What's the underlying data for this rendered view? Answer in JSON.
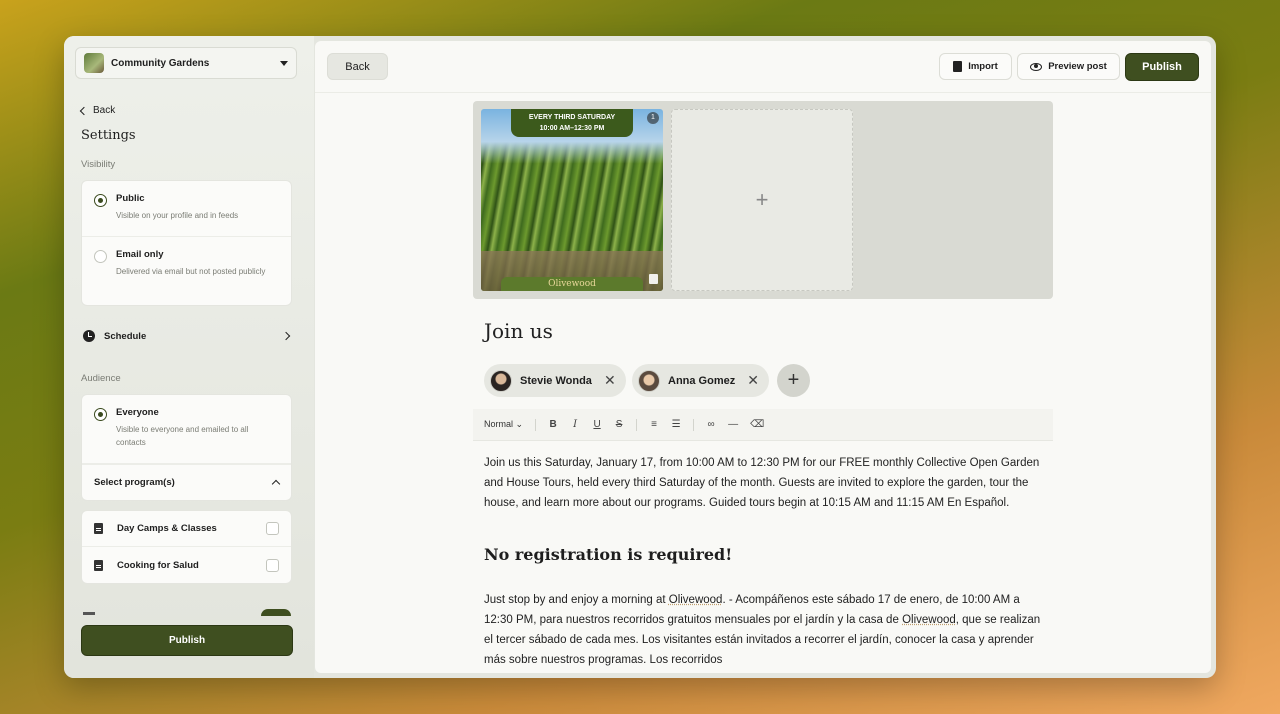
{
  "sidebar": {
    "org_name": "Community Gardens",
    "back_label": "Back",
    "settings_title": "Settings",
    "visibility_label": "Visibility",
    "visibility_options": [
      {
        "title": "Public",
        "desc": "Visible on your profile and in feeds",
        "selected": true
      },
      {
        "title": "Email only",
        "desc": "Delivered via email but not posted publicly",
        "selected": false
      }
    ],
    "schedule_label": "Schedule",
    "audience_label": "Audience",
    "audience_option": {
      "title": "Everyone",
      "desc": "Visible to everyone and emailed to all contacts"
    },
    "select_programs_label": "Select program(s)",
    "programs": [
      "Day Camps & Classes",
      "Cooking for Salud"
    ],
    "publish_label": "Publish"
  },
  "topbar": {
    "back_label": "Back",
    "import_label": "Import",
    "preview_label": "Preview post",
    "publish_label": "Publish"
  },
  "media": {
    "banner_line1": "EVERY THIRD SATURDAY",
    "banner_line2": "10:00 AM–12:30 PM",
    "footer_text": "Olivewood",
    "badge": "1",
    "add_symbol": "+"
  },
  "post": {
    "title": "Join us",
    "people": [
      "Stevie Wonda",
      "Anna Gomez"
    ],
    "toolbar_style": "Normal",
    "paragraph1": "Join us this Saturday, January 17, from 10:00 AM to 12:30 PM for our FREE monthly Collective Open Garden and House Tours, held every third Saturday of the month. Guests are invited to explore the garden, tour the house, and learn more about our programs. Guided tours begin at 10:15 AM and 11:15 AM En Español.",
    "heading2": "No registration is required!",
    "paragraph2a": "Just stop by and enjoy a morning at ",
    "paragraph2_link1": "Olivewood",
    "paragraph2b": ". - Acompáñenos este sábado 17 de enero, de 10:00 AM a 12:30 PM, para nuestros recorridos gratuitos mensuales por el jardín y la casa de ",
    "paragraph2_link2": "Olivewood",
    "paragraph2c": ", que se realizan el tercer sábado de cada mes. Los visitantes están invitados a recorrer el jardín, conocer la casa y aprender más sobre nuestros programas. Los recorridos"
  },
  "colors": {
    "accent": "#3f4f20",
    "panel": "#f9f9f6"
  }
}
